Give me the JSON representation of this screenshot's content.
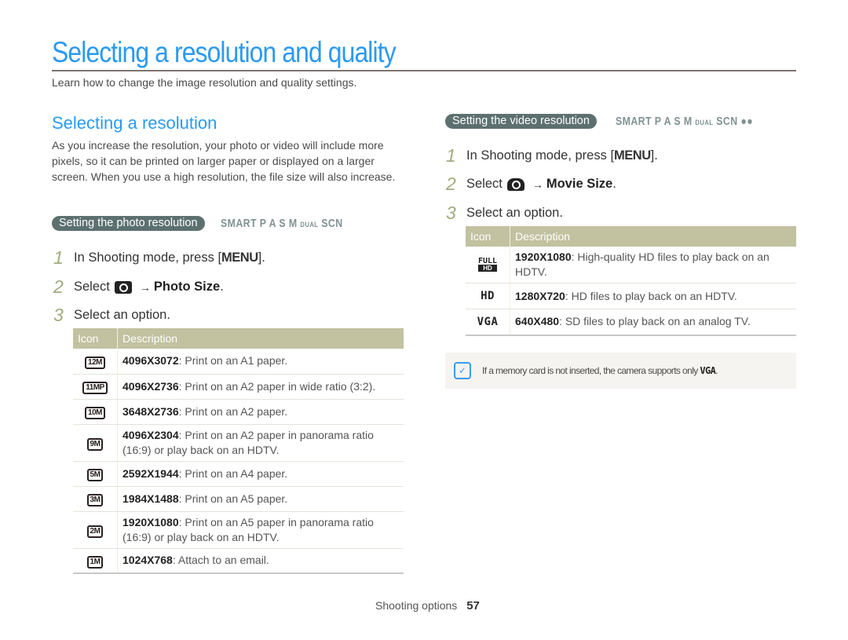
{
  "header": {
    "title": "Selecting a resolution and quality",
    "intro": "Learn how to change the image resolution and quality settings."
  },
  "section": {
    "title": "Selecting a resolution",
    "paragraph": "As you increase the resolution, your photo or video will include more pixels, so it can be printed on larger paper or displayed on a larger screen. When you use a high resolution, the file size will also increase."
  },
  "photo": {
    "pill": "Setting the photo resolution",
    "modes": [
      "SMART",
      "P",
      "A",
      "S",
      "M",
      "DUAL",
      "SCN"
    ],
    "steps": [
      {
        "num": "1",
        "pre": "In Shooting mode, press [",
        "key": "MENU",
        "post": "]."
      },
      {
        "num": "2",
        "pre": "Select",
        "icon": "camera-icon",
        "arrow": "→",
        "bold": "Photo Size",
        "post": "."
      },
      {
        "num": "3",
        "pre": "Select an option."
      }
    ],
    "table": {
      "headers": [
        "Icon",
        "Description"
      ],
      "rows": [
        {
          "icon": "12M",
          "res": "4096X3072",
          "desc": ": Print on an A1 paper."
        },
        {
          "icon": "11MP",
          "res": "4096X2736",
          "desc": ": Print on an A2 paper in wide ratio (3:2)."
        },
        {
          "icon": "10M",
          "res": "3648X2736",
          "desc": ": Print on an A2 paper."
        },
        {
          "icon": "9M",
          "res": "4096X2304",
          "desc": ": Print on an A2 paper in panorama ratio (16:9) or play back on an HDTV."
        },
        {
          "icon": "5M",
          "res": "2592X1944",
          "desc": ": Print on an A4 paper."
        },
        {
          "icon": "3M",
          "res": "1984X1488",
          "desc": ": Print on an A5 paper."
        },
        {
          "icon": "2M",
          "res": "1920X1080",
          "desc": ": Print on an A5 paper in panorama ratio (16:9) or play back on an HDTV."
        },
        {
          "icon": "1M",
          "res": "1024X768",
          "desc": ": Attach to an email."
        }
      ]
    }
  },
  "video": {
    "pill": "Setting the video resolution",
    "modes": [
      "SMART",
      "P",
      "A",
      "S",
      "M",
      "DUAL",
      "SCN"
    ],
    "steps": [
      {
        "num": "1",
        "pre": "In Shooting mode, press [",
        "key": "MENU",
        "post": "]."
      },
      {
        "num": "2",
        "pre": "Select",
        "icon": "movie-camera-icon",
        "arrow": "→",
        "bold": "Movie Size",
        "post": "."
      },
      {
        "num": "3",
        "pre": "Select an option."
      }
    ],
    "table": {
      "headers": [
        "Icon",
        "Description"
      ],
      "rows": [
        {
          "icon_top": "FULL",
          "icon": "HD",
          "res": "1920X1080",
          "desc": ": High-quality HD files to play back on an HDTV."
        },
        {
          "icon": "HD",
          "res": "1280X720",
          "desc": ": HD files to play back on an HDTV."
        },
        {
          "icon": "VGA",
          "res": "640X480",
          "desc": ": SD files to play back on an analog TV."
        }
      ]
    }
  },
  "note": {
    "text": "If a memory card is not inserted, the camera supports only",
    "icon_label": "VGA",
    "end": "."
  },
  "footer": {
    "section": "Shooting options",
    "page": "57"
  },
  "colors": {
    "accent": "#2a9af0",
    "pill": "#5d7070",
    "table_header": "#c2c1a0",
    "step_number": "#9fac7c"
  }
}
